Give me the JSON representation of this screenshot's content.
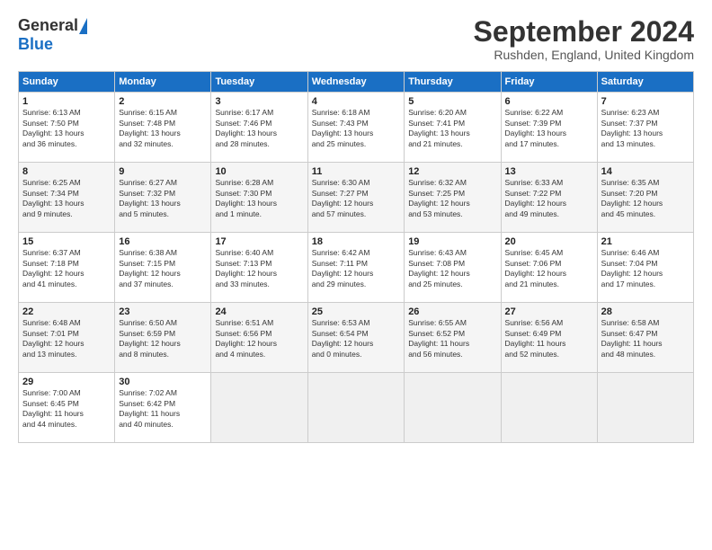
{
  "header": {
    "logo_general": "General",
    "logo_blue": "Blue",
    "month_title": "September 2024",
    "location": "Rushden, England, United Kingdom"
  },
  "weekdays": [
    "Sunday",
    "Monday",
    "Tuesday",
    "Wednesday",
    "Thursday",
    "Friday",
    "Saturday"
  ],
  "weeks": [
    [
      {
        "day": "1",
        "info": "Sunrise: 6:13 AM\nSunset: 7:50 PM\nDaylight: 13 hours\nand 36 minutes."
      },
      {
        "day": "2",
        "info": "Sunrise: 6:15 AM\nSunset: 7:48 PM\nDaylight: 13 hours\nand 32 minutes."
      },
      {
        "day": "3",
        "info": "Sunrise: 6:17 AM\nSunset: 7:46 PM\nDaylight: 13 hours\nand 28 minutes."
      },
      {
        "day": "4",
        "info": "Sunrise: 6:18 AM\nSunset: 7:43 PM\nDaylight: 13 hours\nand 25 minutes."
      },
      {
        "day": "5",
        "info": "Sunrise: 6:20 AM\nSunset: 7:41 PM\nDaylight: 13 hours\nand 21 minutes."
      },
      {
        "day": "6",
        "info": "Sunrise: 6:22 AM\nSunset: 7:39 PM\nDaylight: 13 hours\nand 17 minutes."
      },
      {
        "day": "7",
        "info": "Sunrise: 6:23 AM\nSunset: 7:37 PM\nDaylight: 13 hours\nand 13 minutes."
      }
    ],
    [
      {
        "day": "8",
        "info": "Sunrise: 6:25 AM\nSunset: 7:34 PM\nDaylight: 13 hours\nand 9 minutes."
      },
      {
        "day": "9",
        "info": "Sunrise: 6:27 AM\nSunset: 7:32 PM\nDaylight: 13 hours\nand 5 minutes."
      },
      {
        "day": "10",
        "info": "Sunrise: 6:28 AM\nSunset: 7:30 PM\nDaylight: 13 hours\nand 1 minute."
      },
      {
        "day": "11",
        "info": "Sunrise: 6:30 AM\nSunset: 7:27 PM\nDaylight: 12 hours\nand 57 minutes."
      },
      {
        "day": "12",
        "info": "Sunrise: 6:32 AM\nSunset: 7:25 PM\nDaylight: 12 hours\nand 53 minutes."
      },
      {
        "day": "13",
        "info": "Sunrise: 6:33 AM\nSunset: 7:22 PM\nDaylight: 12 hours\nand 49 minutes."
      },
      {
        "day": "14",
        "info": "Sunrise: 6:35 AM\nSunset: 7:20 PM\nDaylight: 12 hours\nand 45 minutes."
      }
    ],
    [
      {
        "day": "15",
        "info": "Sunrise: 6:37 AM\nSunset: 7:18 PM\nDaylight: 12 hours\nand 41 minutes."
      },
      {
        "day": "16",
        "info": "Sunrise: 6:38 AM\nSunset: 7:15 PM\nDaylight: 12 hours\nand 37 minutes."
      },
      {
        "day": "17",
        "info": "Sunrise: 6:40 AM\nSunset: 7:13 PM\nDaylight: 12 hours\nand 33 minutes."
      },
      {
        "day": "18",
        "info": "Sunrise: 6:42 AM\nSunset: 7:11 PM\nDaylight: 12 hours\nand 29 minutes."
      },
      {
        "day": "19",
        "info": "Sunrise: 6:43 AM\nSunset: 7:08 PM\nDaylight: 12 hours\nand 25 minutes."
      },
      {
        "day": "20",
        "info": "Sunrise: 6:45 AM\nSunset: 7:06 PM\nDaylight: 12 hours\nand 21 minutes."
      },
      {
        "day": "21",
        "info": "Sunrise: 6:46 AM\nSunset: 7:04 PM\nDaylight: 12 hours\nand 17 minutes."
      }
    ],
    [
      {
        "day": "22",
        "info": "Sunrise: 6:48 AM\nSunset: 7:01 PM\nDaylight: 12 hours\nand 13 minutes."
      },
      {
        "day": "23",
        "info": "Sunrise: 6:50 AM\nSunset: 6:59 PM\nDaylight: 12 hours\nand 8 minutes."
      },
      {
        "day": "24",
        "info": "Sunrise: 6:51 AM\nSunset: 6:56 PM\nDaylight: 12 hours\nand 4 minutes."
      },
      {
        "day": "25",
        "info": "Sunrise: 6:53 AM\nSunset: 6:54 PM\nDaylight: 12 hours\nand 0 minutes."
      },
      {
        "day": "26",
        "info": "Sunrise: 6:55 AM\nSunset: 6:52 PM\nDaylight: 11 hours\nand 56 minutes."
      },
      {
        "day": "27",
        "info": "Sunrise: 6:56 AM\nSunset: 6:49 PM\nDaylight: 11 hours\nand 52 minutes."
      },
      {
        "day": "28",
        "info": "Sunrise: 6:58 AM\nSunset: 6:47 PM\nDaylight: 11 hours\nand 48 minutes."
      }
    ],
    [
      {
        "day": "29",
        "info": "Sunrise: 7:00 AM\nSunset: 6:45 PM\nDaylight: 11 hours\nand 44 minutes."
      },
      {
        "day": "30",
        "info": "Sunrise: 7:02 AM\nSunset: 6:42 PM\nDaylight: 11 hours\nand 40 minutes."
      },
      {
        "day": "",
        "info": ""
      },
      {
        "day": "",
        "info": ""
      },
      {
        "day": "",
        "info": ""
      },
      {
        "day": "",
        "info": ""
      },
      {
        "day": "",
        "info": ""
      }
    ]
  ]
}
